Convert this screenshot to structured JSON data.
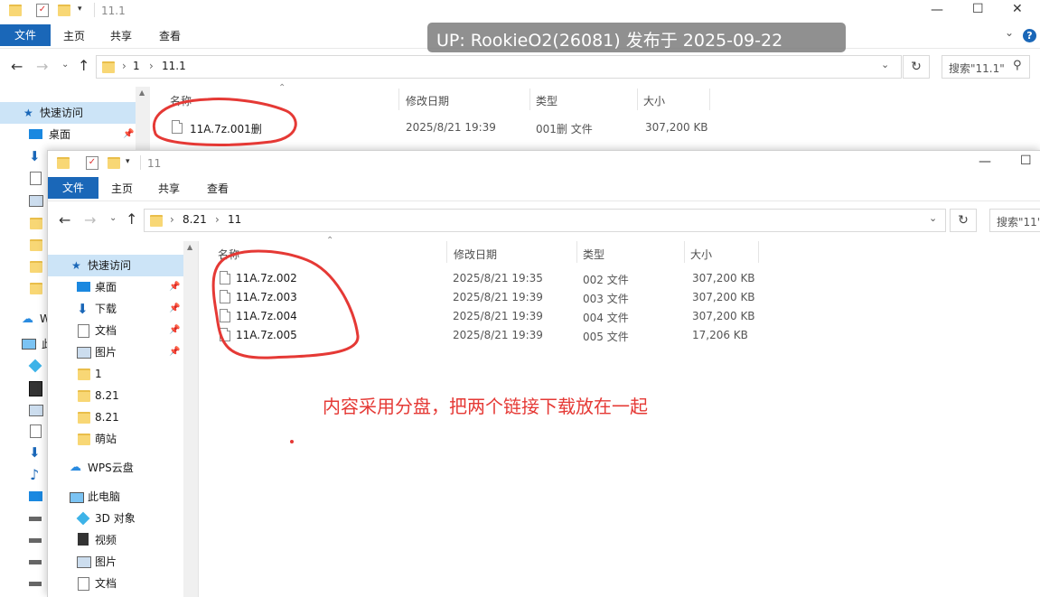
{
  "watermark": "UP: RookieO2(26081) 发布于 2025-09-22",
  "annotation": "内容采用分盘，把两个链接下载放在一起",
  "back_window": {
    "title": "11.1",
    "ribbon": {
      "file": "文件",
      "home": "主页",
      "share": "共享",
      "view": "查看"
    },
    "breadcrumb": [
      "1",
      "11.1"
    ],
    "search_placeholder": "搜索\"11.1\"",
    "columns": {
      "name": "名称",
      "date": "修改日期",
      "type": "类型",
      "size": "大小"
    },
    "files": [
      {
        "name": "11A.7z.001删",
        "date": "2025/8/21 19:39",
        "type": "001删 文件",
        "size": "307,200 KB"
      }
    ],
    "sidebar": {
      "quick_access": "快速访问",
      "desktop": "桌面",
      "wps_partial": "W",
      "pc_partial": "此"
    }
  },
  "front_window": {
    "title": "11",
    "ribbon": {
      "file": "文件",
      "home": "主页",
      "share": "共享",
      "view": "查看"
    },
    "breadcrumb": [
      "8.21",
      "11"
    ],
    "search_placeholder": "搜索\"11\"",
    "columns": {
      "name": "名称",
      "date": "修改日期",
      "type": "类型",
      "size": "大小"
    },
    "files": [
      {
        "name": "11A.7z.002",
        "date": "2025/8/21 19:35",
        "type": "002 文件",
        "size": "307,200 KB"
      },
      {
        "name": "11A.7z.003",
        "date": "2025/8/21 19:39",
        "type": "003 文件",
        "size": "307,200 KB"
      },
      {
        "name": "11A.7z.004",
        "date": "2025/8/21 19:39",
        "type": "004 文件",
        "size": "307,200 KB"
      },
      {
        "name": "11A.7z.005",
        "date": "2025/8/21 19:39",
        "type": "005 文件",
        "size": "17,206 KB"
      }
    ],
    "sidebar": {
      "quick_access": "快速访问",
      "pinned": [
        "桌面",
        "下载",
        "文档",
        "图片"
      ],
      "folders": [
        "1",
        "8.21",
        "8.21",
        "萌站"
      ],
      "wps": "WPS云盘",
      "pc": "此电脑",
      "pc_items": [
        "3D 对象",
        "视频",
        "图片",
        "文档"
      ]
    }
  },
  "colors": {
    "accent": "#1a67b8",
    "selection": "#cce4f7",
    "annotation": "#e53935"
  }
}
